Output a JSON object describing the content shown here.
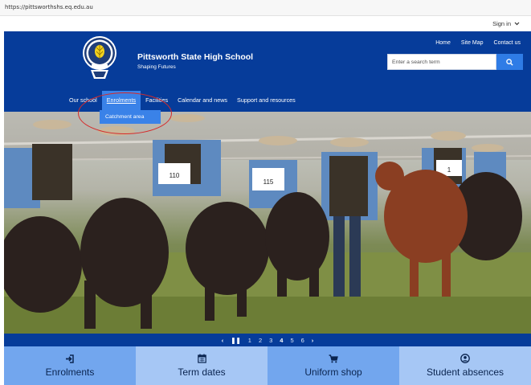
{
  "browser": {
    "url": "https://pittsworthshs.eq.edu.au"
  },
  "header": {
    "sign_in": "Sign in",
    "school_name": "Pittsworth State High School",
    "tagline": "Shaping Futures",
    "top_links": [
      "Home",
      "Site Map",
      "Contact us"
    ],
    "search": {
      "placeholder": "Enter a search term"
    }
  },
  "nav": {
    "items": [
      {
        "label": "Our school"
      },
      {
        "label": "Enrolments",
        "active": true
      },
      {
        "label": "Facilities"
      },
      {
        "label": "Calendar and news"
      },
      {
        "label": "Support and resources"
      }
    ],
    "dropdown": {
      "items": [
        "Catchment area"
      ]
    }
  },
  "carousel": {
    "prev": "‹",
    "pause": "❚❚",
    "pages": [
      "1",
      "2",
      "3",
      "4",
      "5",
      "6"
    ],
    "current_page": "4",
    "next": "›"
  },
  "hero": {
    "tags": [
      "110",
      "115",
      "1"
    ]
  },
  "tiles": [
    {
      "label": "Enrolments",
      "icon": "sign-in-icon"
    },
    {
      "label": "Term dates",
      "icon": "calendar-icon"
    },
    {
      "label": "Uniform shop",
      "icon": "shopping-cart-icon"
    },
    {
      "label": "Student absences",
      "icon": "user-circle-icon"
    }
  ],
  "colors": {
    "header_blue": "#063c9a",
    "accent_blue": "#3a82e8",
    "annotation_red": "#d62a2a"
  }
}
